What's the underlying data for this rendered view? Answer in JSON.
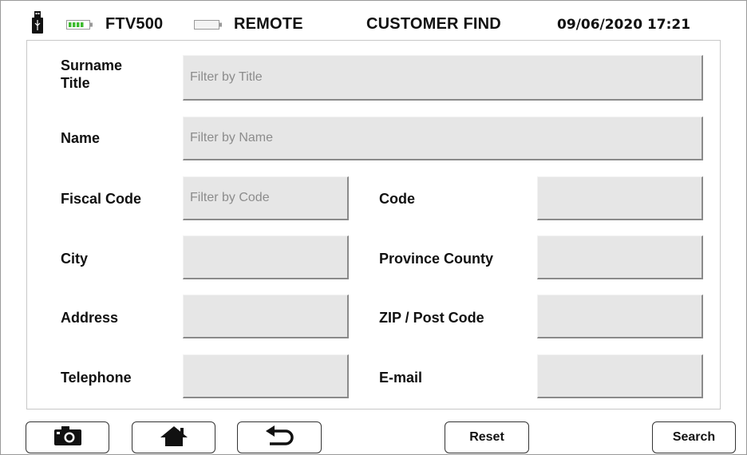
{
  "header": {
    "device_name": "FTV500",
    "mode": "REMOTE",
    "screen_title": "CUSTOMER FIND",
    "datetime": "09/06/2020 17:21",
    "icons": [
      "usb-icon",
      "battery-full-icon",
      "battery-empty-icon"
    ]
  },
  "form": {
    "surname_title_label": "Surname\nTitle",
    "surname_title_placeholder": "Filter by Title",
    "name_label": "Name",
    "name_placeholder": "Filter by Name",
    "fiscal_code_label": "Fiscal Code",
    "fiscal_code_placeholder": "Filter by Code",
    "code_label": "Code",
    "city_label": "City",
    "province_label": "Province County",
    "address_label": "Address",
    "zip_label": "ZIP / Post Code",
    "telephone_label": "Telephone",
    "email_label": "E-mail"
  },
  "footer": {
    "camera_icon": "camera-icon",
    "home_icon": "home-icon",
    "back_icon": "back-arrow-icon",
    "reset_label": "Reset",
    "search_label": "Search"
  },
  "colors": {
    "battery_green": "#3dbb2e",
    "field_bg": "#e6e6e6",
    "placeholder_text": "#8c8c8c"
  }
}
